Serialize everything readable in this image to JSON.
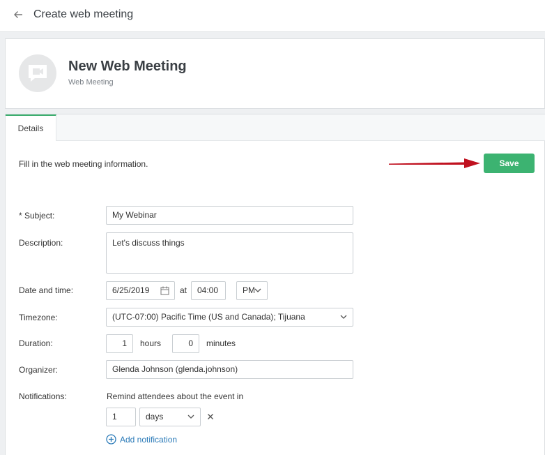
{
  "topbar": {
    "title": "Create web meeting"
  },
  "header": {
    "name": "New Web Meeting",
    "type": "Web Meeting"
  },
  "tabs": [
    {
      "label": "Details"
    }
  ],
  "form": {
    "intro": "Fill in the web meeting information.",
    "save_label": "Save",
    "subject": {
      "label": "* Subject:",
      "value": "My Webinar"
    },
    "description": {
      "label": "Description:",
      "value": "Let's discuss things"
    },
    "datetime": {
      "label": "Date and time:",
      "date": "6/25/2019",
      "at": "at",
      "time": "04:00",
      "ampm": "PM"
    },
    "timezone": {
      "label": "Timezone:",
      "value": "(UTC-07:00) Pacific Time (US and Canada); Tijuana"
    },
    "duration": {
      "label": "Duration:",
      "hours": "1",
      "hours_unit": "hours",
      "minutes": "0",
      "minutes_unit": "minutes"
    },
    "organizer": {
      "label": "Organizer:",
      "value": "Glenda Johnson (glenda.johnson)"
    },
    "notifications": {
      "label": "Notifications:",
      "remind_text": "Remind attendees about the event in",
      "amount": "1",
      "unit": "days",
      "add_label": "Add notification"
    }
  },
  "colors": {
    "accent_green": "#3cb371",
    "link_blue": "#2a7ab8",
    "arrow_red": "#c0111f"
  },
  "icons": {
    "back": "arrow-left-icon",
    "avatar": "video-camera-icon",
    "calendar": "calendar-icon",
    "chevron": "chevron-down-icon",
    "remove": "close-icon",
    "add": "plus-circle-icon"
  }
}
